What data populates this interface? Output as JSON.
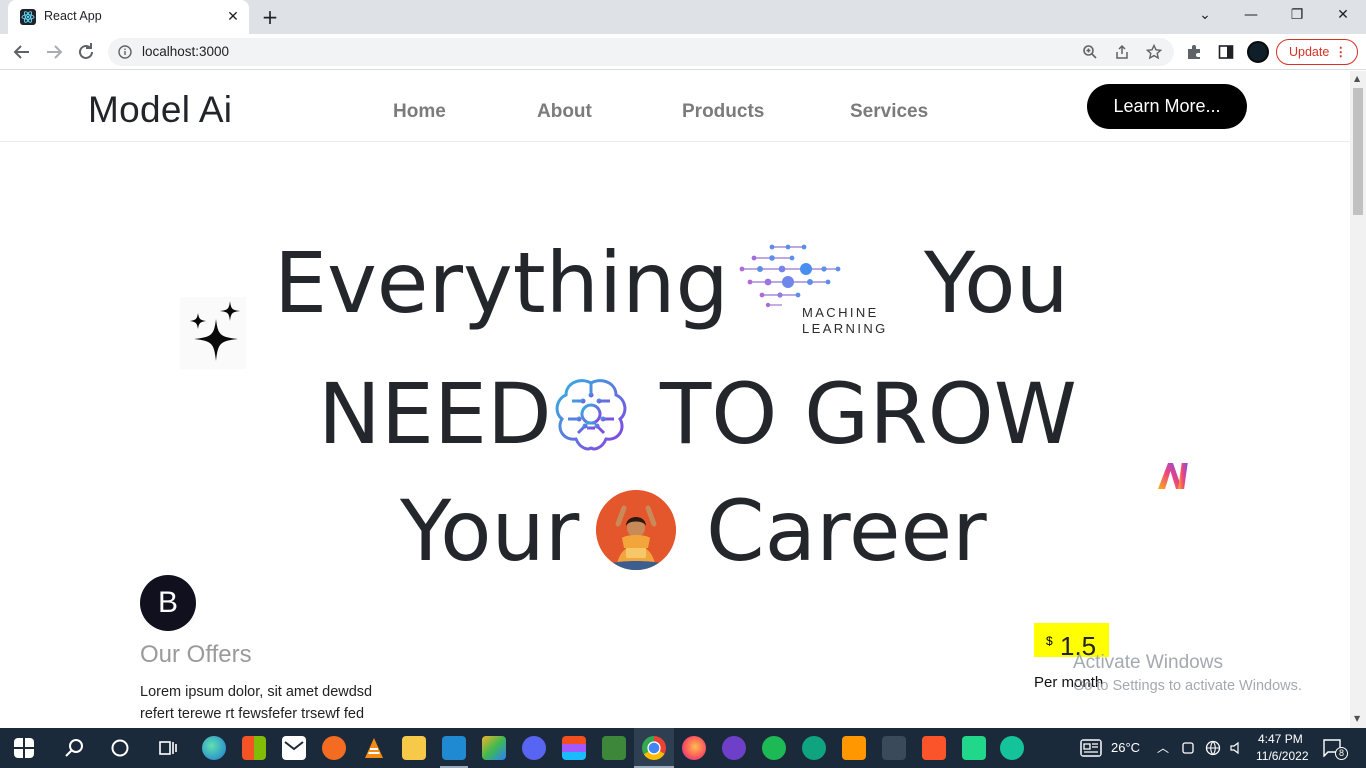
{
  "browser": {
    "tab_title": "React App",
    "tab_close": "✕",
    "new_tab": "+",
    "url": "localhost:3000",
    "update_label": "Update",
    "update_menu": "⋮",
    "window_controls": {
      "minimize": "—",
      "maximize": "❐",
      "close": "✕",
      "tab_search": "⌄"
    }
  },
  "site": {
    "brand": "Model Ai",
    "nav": [
      "Home",
      "About",
      "Products",
      "Services"
    ],
    "cta": "Learn More...",
    "hero": {
      "line1_a": "Everything",
      "line1_b": "You",
      "line2_a": "NEED",
      "line2_b": "TO GROW",
      "line3_a": "Your",
      "line3_b": "Career",
      "ml_logo_text_1": "MACHINE",
      "ml_logo_text_2": "LEARNING"
    },
    "offers": {
      "badge": "B",
      "title": "Our Offers",
      "text": "Lorem ipsum dolor, sit amet dewdsd refert terewe rt fewsfefer trsewf fed"
    },
    "pricing": {
      "currency": "$",
      "value": "1.5",
      "period": "Per month"
    }
  },
  "watermark": {
    "line1": "Activate Windows",
    "line2": "Go to Settings to activate Windows."
  },
  "taskbar": {
    "temperature": "26°C",
    "time": "4:47 PM",
    "date": "11/6/2022",
    "notifications": "8"
  },
  "colors": {
    "cta_bg": "#000000",
    "price_highlight": "#ffff00",
    "update_red": "#d93025",
    "taskbar_bg": "#1b2a3a"
  }
}
